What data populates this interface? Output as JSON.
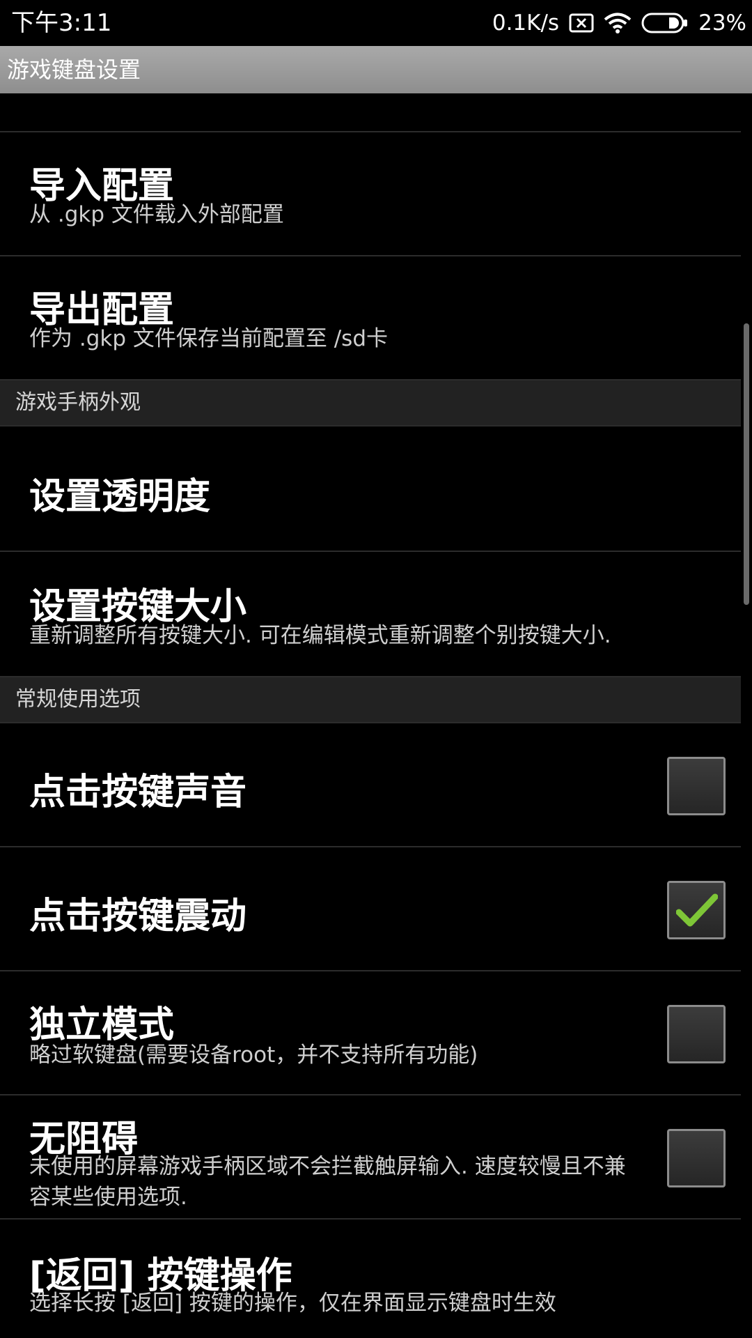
{
  "status": {
    "time": "下午3:11",
    "speed": "0.1K/s",
    "battery": "23%",
    "icons": [
      "sim-disabled-icon",
      "wifi-icon",
      "battery-icon"
    ]
  },
  "title": "游戏键盘设置",
  "items": {
    "import": {
      "title": "导入配置",
      "summary": "从 .gkp 文件载入外部配置"
    },
    "export": {
      "title": "导出配置",
      "summary": "作为 .gkp 文件保存当前配置至 /sd卡"
    },
    "opacity": {
      "title": "设置透明度"
    },
    "keysize": {
      "title": "设置按键大小",
      "summary": "重新调整所有按键大小. 可在编辑模式重新调整个别按键大小."
    },
    "sound": {
      "title": "点击按键声音",
      "checked": false
    },
    "vibrate": {
      "title": "点击按键震动",
      "checked": true
    },
    "standalone": {
      "title": "独立模式",
      "summary": "略过软键盘(需要设备root，并不支持所有功能)",
      "checked": false
    },
    "accessible": {
      "title": "无阻碍",
      "summary": "未使用的屏幕游戏手柄区域不会拦截触屏输入. 速度较慢且不兼容某些使用选项.",
      "checked": false
    },
    "back": {
      "title": "[返回] 按键操作",
      "summary": "选择长按 [返回] 按键的操作，仅在界面显示键盘时生效"
    }
  },
  "sections": {
    "appearance": "游戏手柄外观",
    "general": "常规使用选项"
  },
  "colors": {
    "check_green": "#7ec637",
    "title_bar": "#9c9c9c"
  }
}
